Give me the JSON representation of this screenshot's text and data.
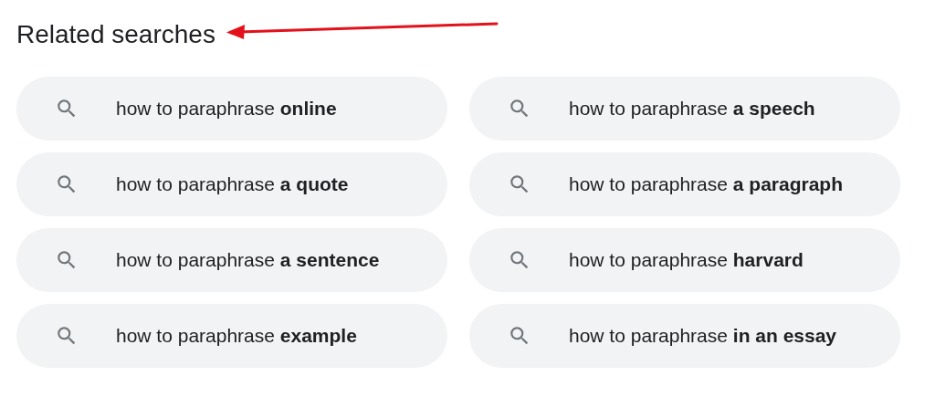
{
  "heading": "Related searches",
  "searches": [
    {
      "text": "how to paraphrase **online**"
    },
    {
      "text": "how to paraphrase **a speech**"
    },
    {
      "text": "how to paraphrase **a quote**"
    },
    {
      "text": "how to paraphrase **a paragraph**"
    },
    {
      "text": "how to paraphrase **a sentence**"
    },
    {
      "text": "how to paraphrase **harvard**"
    },
    {
      "text": "how to paraphrase **example**"
    },
    {
      "text": "how to paraphrase **in an essay**"
    }
  ]
}
